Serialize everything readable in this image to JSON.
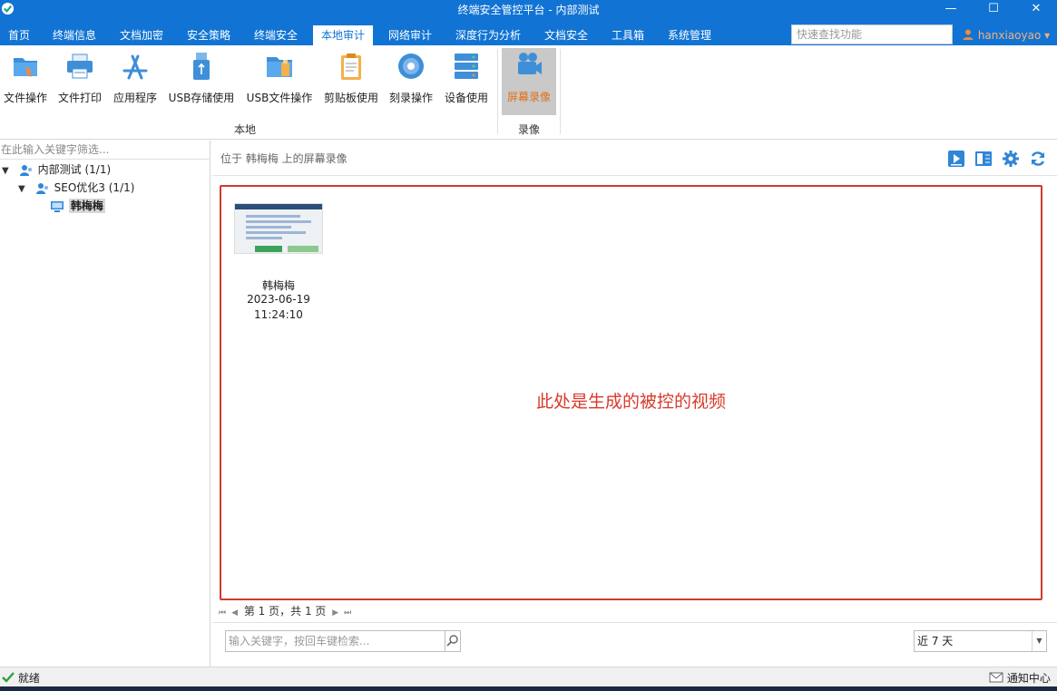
{
  "window": {
    "title": "终端安全管控平台 - 内部测试",
    "minimize": "—",
    "maximize": "☐",
    "close": "✕"
  },
  "menu": [
    {
      "label": "首页"
    },
    {
      "label": "终端信息"
    },
    {
      "label": "文档加密"
    },
    {
      "label": "安全策略"
    },
    {
      "label": "终端安全"
    },
    {
      "label": "本地审计"
    },
    {
      "label": "网络审计"
    },
    {
      "label": "深度行为分析"
    },
    {
      "label": "文档安全"
    },
    {
      "label": "工具箱"
    },
    {
      "label": "系统管理"
    }
  ],
  "search_fn": {
    "placeholder": "快速查找功能"
  },
  "user": {
    "name": "hanxiaoyao",
    "chevron": "▾"
  },
  "ribbon": {
    "local_group": "本地",
    "record_group": "录像",
    "buttons": [
      {
        "label": "文件操作",
        "icon": "file-operation-icon"
      },
      {
        "label": "文件打印",
        "icon": "printer-icon"
      },
      {
        "label": "应用程序",
        "icon": "app-store-icon"
      },
      {
        "label": "USB存储使用",
        "icon": "usb-storage-icon"
      },
      {
        "label": "USB文件操作",
        "icon": "usb-file-icon"
      },
      {
        "label": "剪贴板使用",
        "icon": "clipboard-icon"
      },
      {
        "label": "刻录操作",
        "icon": "disc-burn-icon"
      },
      {
        "label": "设备使用",
        "icon": "device-icon"
      },
      {
        "label": "屏幕录像",
        "icon": "video-camera-icon"
      }
    ]
  },
  "left": {
    "filter_placeholder": "在此输入关键字筛选...",
    "tree": [
      {
        "label": "内部测试 (1/1)"
      },
      {
        "label": "SEO优化3 (1/1)"
      },
      {
        "label": "韩梅梅"
      }
    ]
  },
  "main": {
    "location": "位于 韩梅梅 上的屏幕录像",
    "videos": [
      {
        "name": "韩梅梅",
        "date": "2023-06-19",
        "time": "11:24:10"
      }
    ],
    "annotation": "此处是生成的被控的视频",
    "pager": {
      "text": "第 1 页，共 1 页"
    },
    "keyword_placeholder": "输入关键字，按回车键检索...",
    "range": "近 7 天"
  },
  "status": {
    "text": "就绪",
    "notify": "通知中心"
  },
  "colors": {
    "brand": "#1174d4",
    "active_tab_text": "#1174d4",
    "annotation": "#d83a2c",
    "ribbon_active_label": "#e07018"
  }
}
